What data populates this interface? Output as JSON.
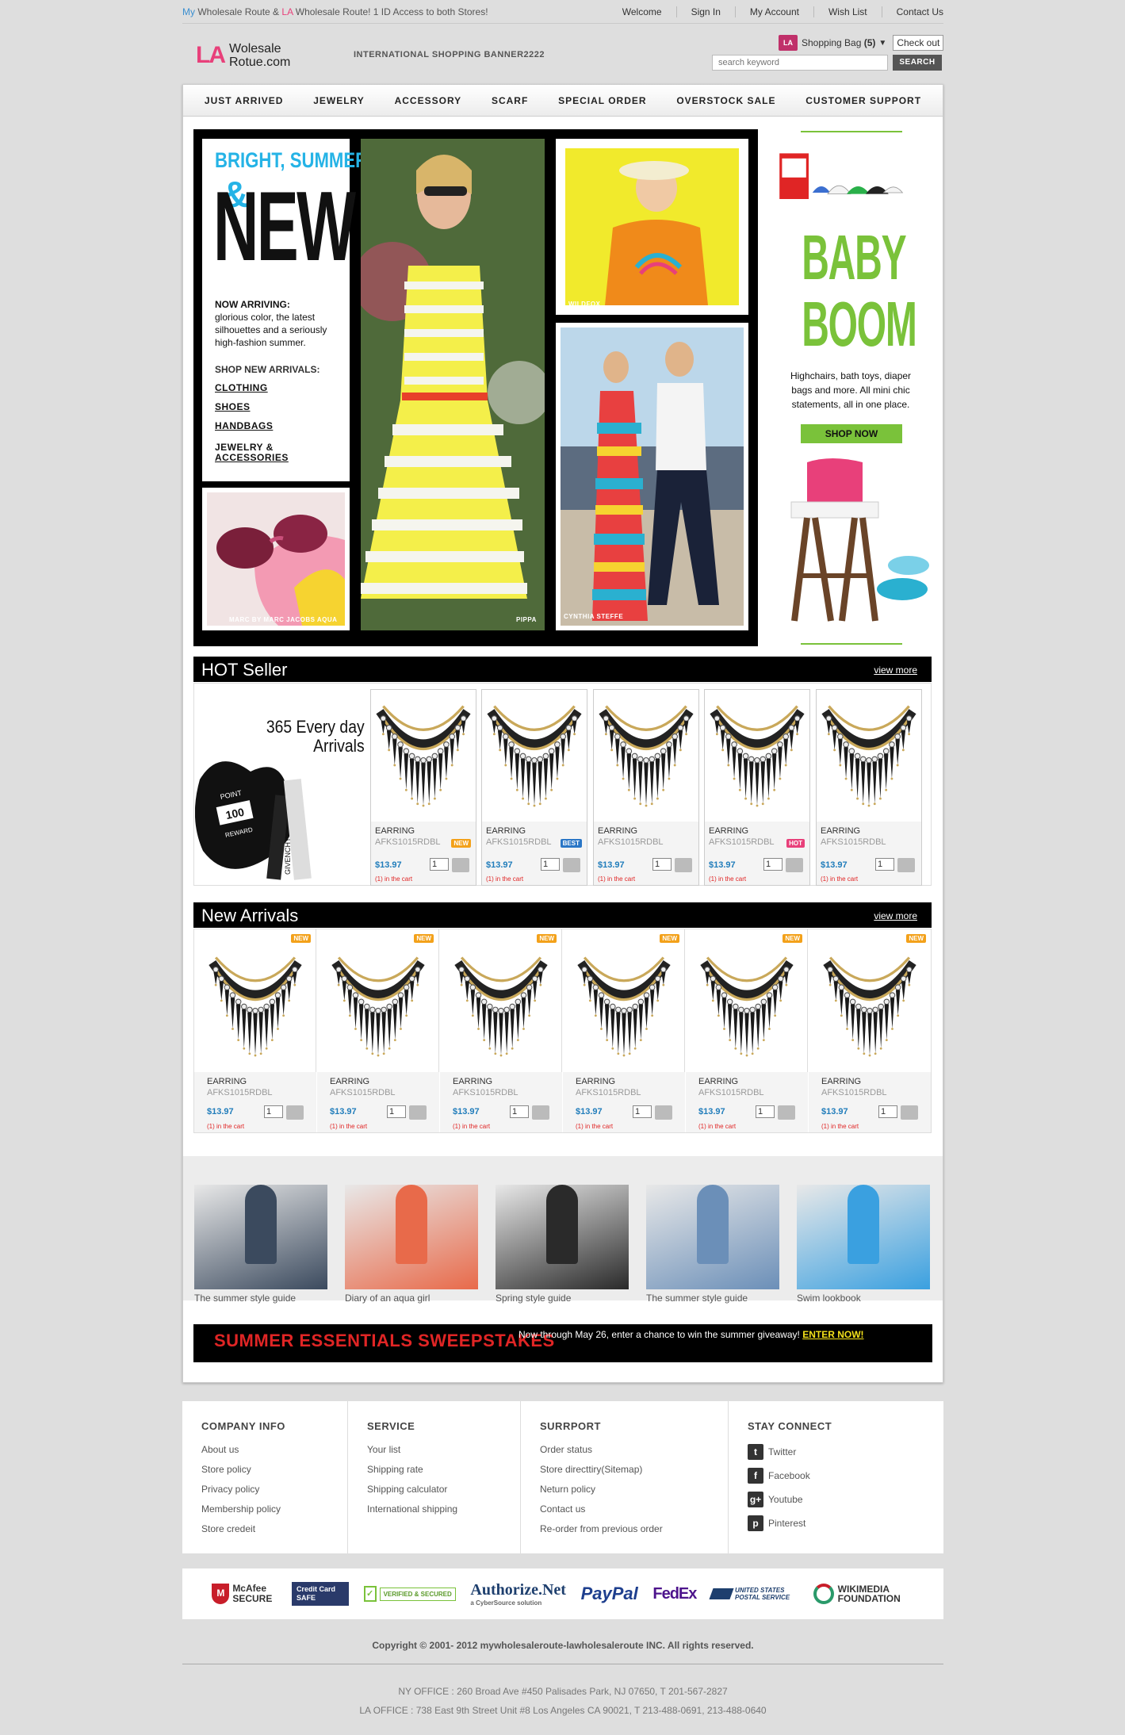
{
  "topbar": {
    "promo_my": "My",
    "promo_mid": " Wholesale Route & ",
    "promo_la": "LA",
    "promo_end": " Wholesale Route! 1 ID Access to both Stores!",
    "links": [
      "Welcome",
      "Sign In",
      "My Account",
      "Wish List",
      "Contact Us"
    ]
  },
  "header": {
    "logo_mark": "LA",
    "logo_line1": "Wolesale",
    "logo_line2": "Rotue.com",
    "banner_text": "INTERNATIONAL SHOPPING BANNER2222",
    "bag_label": "Shopping Bag",
    "bag_count": "(5)",
    "bag_icon": "LA",
    "checkout": "Check out",
    "search_placeholder": "search keyword",
    "search_button": "SEARCH"
  },
  "nav": [
    "JUST ARRIVED",
    "JEWELRY",
    "ACCESSORY",
    "SCARF",
    "SPECIAL ORDER",
    "OVERSTOCK SALE",
    "CUSTOMER SUPPORT"
  ],
  "hero": {
    "headline": "BRIGHT, SUMMERY",
    "amp": "&",
    "new": "NEW",
    "now_arriving": "NOW ARRIVING:",
    "desc": "glorious color, the latest silhouettes and a seriously high-fashion summer.",
    "shop_label": "SHOP NEW ARRIVALS:",
    "links": [
      "CLOTHING",
      "SHOES",
      "HANDBAGS",
      "JEWELRY &",
      "ACCESSORIES"
    ],
    "captions": {
      "glasses": "MARC BY MARC JACOBS    AQUA",
      "dress": "PIPPA",
      "wildfox": "WILDFOX",
      "couple": "CYNTHIA STEFFE"
    }
  },
  "baby": {
    "title1": "BABY",
    "title2": "BOOM",
    "text": "Highchairs, bath toys, diaper bags and more. All mini chic statements, all in one place.",
    "button": "SHOP NOW"
  },
  "hot": {
    "title": "HOT Seller",
    "more": "view more",
    "promo_line1": "365 Every day",
    "promo_line2": "Arrivals",
    "promo_point": "POINT",
    "promo_100": "100",
    "promo_reward": "REWARD",
    "promo_brand": "GIVENCHY",
    "products": [
      {
        "name": "EARRING",
        "code": "AFKS1015RDBL",
        "price": "$13.97",
        "qty": "1",
        "incart": "(1) in the cart",
        "badge": "NEW"
      },
      {
        "name": "EARRING",
        "code": "AFKS1015RDBL",
        "price": "$13.97",
        "qty": "1",
        "incart": "(1) in the cart",
        "badge": "BEST"
      },
      {
        "name": "EARRING",
        "code": "AFKS1015RDBL",
        "price": "$13.97",
        "qty": "1",
        "incart": "(1) in the cart",
        "badge": ""
      },
      {
        "name": "EARRING",
        "code": "AFKS1015RDBL",
        "price": "$13.97",
        "qty": "1",
        "incart": "(1) in the cart",
        "badge": "HOT"
      },
      {
        "name": "EARRING",
        "code": "AFKS1015RDBL",
        "price": "$13.97",
        "qty": "1",
        "incart": "(1) in the cart",
        "badge": ""
      }
    ]
  },
  "arrivals": {
    "title": "New Arrivals",
    "more": "view more",
    "products": [
      {
        "name": "EARRING",
        "code": "AFKS1015RDBL",
        "price": "$13.97",
        "qty": "1",
        "incart": "(1) in the cart",
        "badge": "NEW"
      },
      {
        "name": "EARRING",
        "code": "AFKS1015RDBL",
        "price": "$13.97",
        "qty": "1",
        "incart": "(1) in the cart",
        "badge": "NEW"
      },
      {
        "name": "EARRING",
        "code": "AFKS1015RDBL",
        "price": "$13.97",
        "qty": "1",
        "incart": "(1) in the cart",
        "badge": "NEW"
      },
      {
        "name": "EARRING",
        "code": "AFKS1015RDBL",
        "price": "$13.97",
        "qty": "1",
        "incart": "(1) in the cart",
        "badge": "NEW"
      },
      {
        "name": "EARRING",
        "code": "AFKS1015RDBL",
        "price": "$13.97",
        "qty": "1",
        "incart": "(1) in the cart",
        "badge": "NEW"
      },
      {
        "name": "EARRING",
        "code": "AFKS1015RDBL",
        "price": "$13.97",
        "qty": "1",
        "incart": "(1) in the cart",
        "badge": "NEW"
      }
    ]
  },
  "lookbook": [
    {
      "label": "The summer style guide",
      "color": "#3b4a5e"
    },
    {
      "label": "Diary of an aqua girl",
      "color": "#e86a4a"
    },
    {
      "label": "Spring style guide",
      "color": "#2a2a2a"
    },
    {
      "label": "The summer style guide",
      "color": "#6b8fb8"
    },
    {
      "label": "Swim lookbook",
      "color": "#3aa0e0"
    }
  ],
  "sweep": {
    "title": "SUMMER ESSENTIALS SWEEPSTAKES",
    "text": "Now through May 26, enter a chance to win the summer giveaway!",
    "enter": "ENTER NOW!"
  },
  "footer": {
    "company": {
      "title": "COMPANY INFO",
      "links": [
        "About us",
        "Store policy",
        "Privacy policy",
        "Membership policy",
        "Store credeit"
      ]
    },
    "service": {
      "title": "SERVICE",
      "links": [
        "Your list",
        "Shipping rate",
        "Shipping calculator",
        "International shipping"
      ]
    },
    "support": {
      "title": "SURRPORT",
      "links": [
        "Order status",
        "Store directtiry(Sitemap)",
        "Neturn policy",
        "Contact us",
        "Re-order from previous order"
      ]
    },
    "connect": {
      "title": "STAY CONNECT",
      "links": [
        "Twitter",
        "Facebook",
        "Youtube",
        "Pinterest"
      ]
    }
  },
  "trust": {
    "mcafee": "McAfee SECURE",
    "security": "Credit Card SAFE",
    "godaddy": "VERIFIED & SECURED",
    "authorize": "Authorize.Net",
    "authorize_sub": "a CyberSource solution",
    "paypal": "PayPal",
    "fedex": "FedEx",
    "usps": "UNITED STATES POSTAL SERVICE",
    "wikimedia": "WIKIMEDIA FOUNDATION"
  },
  "bottom": {
    "copyright": "Copyright © 2001- 2012 mywholesaleroute-lawholesaleroute INC. All rights reserved.",
    "ny": "NY OFFICE : 260 Broad Ave #450 Palisades Park, NJ 07650, T 201-567-2827",
    "la": "LA OFFICE : 738 East 9th Street Unit #8 Los Angeles CA 90021, T 213-488-0691, 213-488-0640"
  }
}
